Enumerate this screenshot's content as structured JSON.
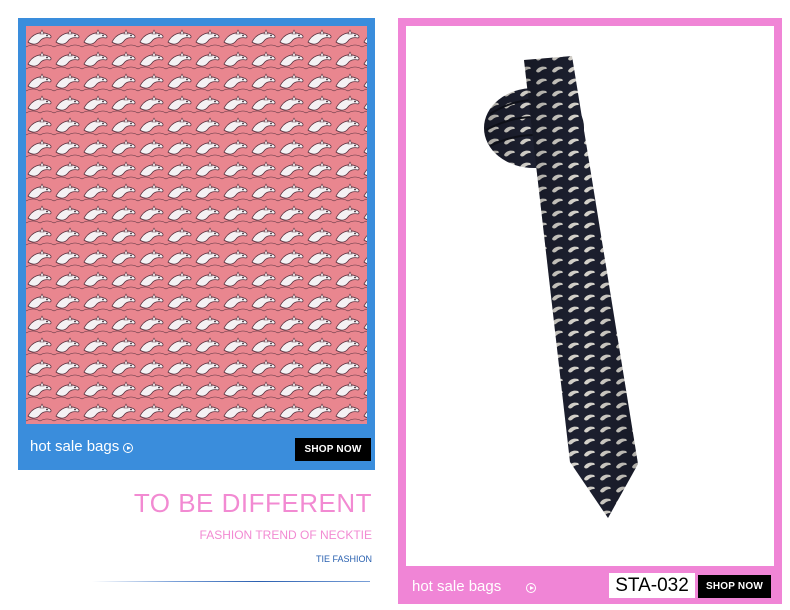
{
  "left_card": {
    "label": "hot sale bags",
    "button": "SHOP NOW",
    "accent": "#3a8ddc"
  },
  "right_card": {
    "label": "hot sale bags",
    "button": "SHOP NOW",
    "sku": "STA-032",
    "accent": "#f085d6"
  },
  "promo": {
    "headline": "TO BE DIFFERENT",
    "subhead": "FASHION TREND OF NECKTIE",
    "tagline": "TIE FASHION"
  },
  "icons": {
    "arrow": "circle-arrow-right-icon"
  }
}
